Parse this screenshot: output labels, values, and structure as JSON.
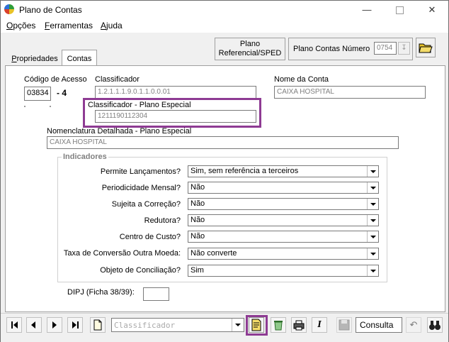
{
  "window": {
    "title": "Plano de Contas"
  },
  "menu": [
    {
      "label": "Opções",
      "accel": "O",
      "rest": "pções"
    },
    {
      "label": "Ferramentas",
      "accel": "F",
      "rest": "erramentas"
    },
    {
      "label": "Ajuda",
      "accel": "A",
      "rest": "juda"
    }
  ],
  "tabs": [
    {
      "accel": "P",
      "rest": "ropriedades",
      "active": false
    },
    {
      "accel": "",
      "rest": "Contas",
      "active": true
    }
  ],
  "top_buttons": {
    "plano_referencial": {
      "line1": "Plano",
      "line2": "Referencial/SPED"
    },
    "plano_contas_numero": {
      "label": "Plano Contas Número",
      "value": "0754"
    }
  },
  "form": {
    "codigo_acesso": {
      "label": "Código de Acesso",
      "value": "03834",
      "digit": "- 4"
    },
    "classificador": {
      "label": "Classificador",
      "value": "1.2.1.1.1.9.0.1.1.0.0.01"
    },
    "nome_conta": {
      "label": "Nome da Conta",
      "value": "CAIXA HOSPITAL"
    },
    "classificador_especial": {
      "label": "Classificador  - Plano Especial",
      "value": "1211190112304"
    },
    "nomenclatura": {
      "label": "Nomenclatura Detalhada - Plano Especial",
      "value": "CAIXA HOSPITAL"
    }
  },
  "indicadores": {
    "title": "Indicadores",
    "rows": [
      {
        "label": "Permite Lançamentos?",
        "value": "Sim, sem referência a terceiros"
      },
      {
        "label": "Periodicidade Mensal?",
        "value": "Não"
      },
      {
        "label": "Sujeita a Correção?",
        "value": "Não"
      },
      {
        "label": "Redutora?",
        "value": "Não"
      },
      {
        "label": "Centro de Custo?",
        "value": "Não"
      },
      {
        "label": "Taxa de Conversão Outra Moeda:",
        "value": "Não converte"
      },
      {
        "label": "Objeto de Conciliação?",
        "value": "Sim"
      }
    ]
  },
  "dipj": {
    "label": "DIPJ (Ficha 38/39):",
    "value": ""
  },
  "toolbar": {
    "search_placeholder": "Classificador",
    "mode_label": "Consulta"
  },
  "colors": {
    "highlight": "#8e3b93"
  }
}
